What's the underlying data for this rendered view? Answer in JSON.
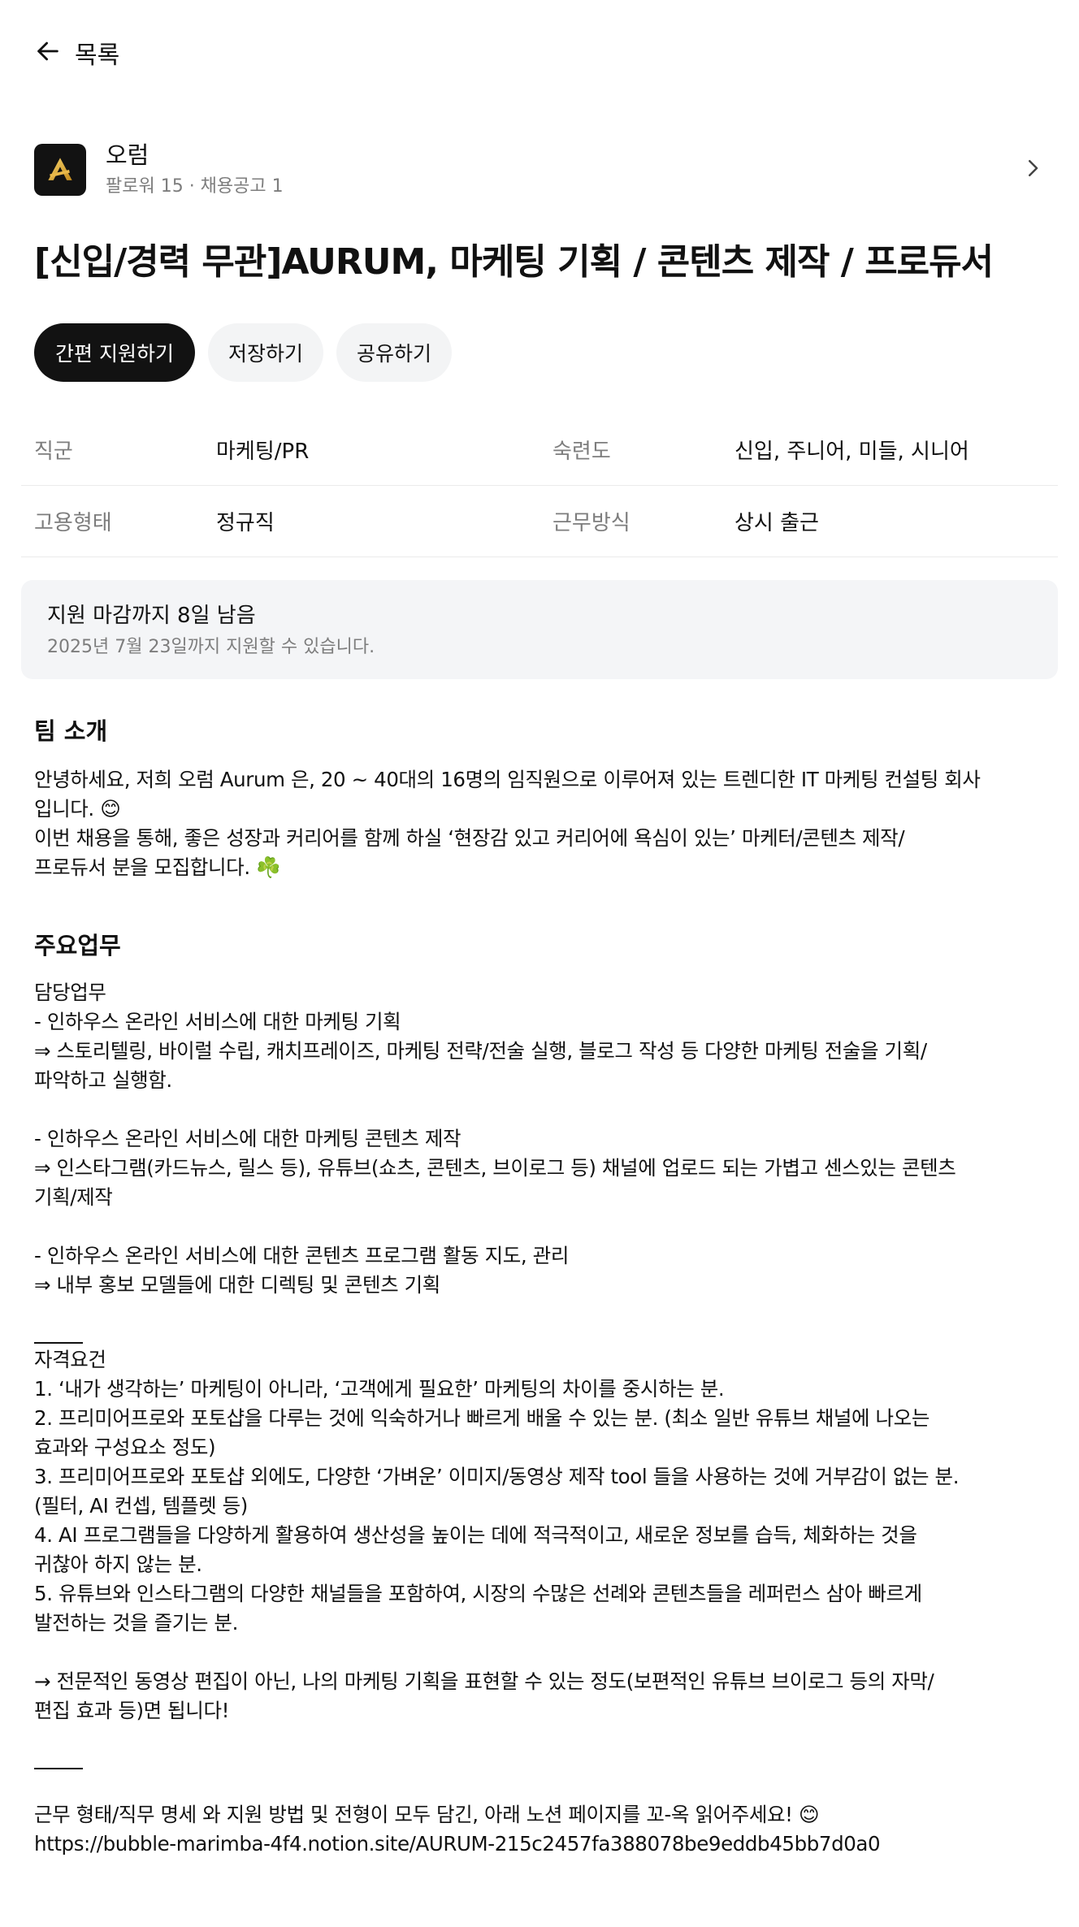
{
  "nav": {
    "back_label": "목록"
  },
  "company": {
    "logo_icon": "aurum-logo-icon",
    "name": "오럼",
    "meta": "팔로워 15 · 채용공고 1"
  },
  "job": {
    "title": "[신입/경력 무관]AURUM, 마케팅 기획 / 콘텐츠 제작 / 프로듀서"
  },
  "actions": {
    "apply": "간편 지원하기",
    "save": "저장하기",
    "share": "공유하기"
  },
  "info": {
    "row1": {
      "label_a": "직군",
      "value_a": "마케팅/PR",
      "label_b": "숙련도",
      "value_b": "신입, 주니어, 미들, 시니어"
    },
    "row2": {
      "label_a": "고용형태",
      "value_a": "정규직",
      "label_b": "근무방식",
      "value_b": "상시 출근"
    }
  },
  "deadline": {
    "title": "지원 마감까지 8일 남음",
    "subtitle": "2025년 7월 23일까지 지원할 수 있습니다."
  },
  "team": {
    "heading": "팀 소개",
    "lines": [
      "안녕하세요, 저희 오럼 Aurum 은, 20 ~ 40대의 16명의 임직원으로 이루어져 있는 트렌디한 IT 마케팅 컨설팅 회사",
      "입니다. 😊",
      "이번 채용을 통해, 좋은 성장과 커리어를 함께 하실 ‘현장감 있고 커리어에 욕심이 있는’ 마케터/콘텐츠 제작/",
      "프로듀서 분을 모집합니다. ☘️"
    ]
  },
  "duties": {
    "heading": "주요업무",
    "lines": [
      "담당업무",
      "- 인하우스 온라인 서비스에 대한 마케팅 기획",
      "⇒ 스토리텔링, 바이럴 수립, 캐치프레이즈, 마케팅 전략/전술 실행, 블로그 작성 등 다양한 마케팅 전술을 기획/",
      "파악하고 실행함.",
      "",
      "- 인하우스 온라인 서비스에 대한 마케팅 콘텐츠 제작",
      "⇒ 인스타그램(카드뉴스, 릴스 등), 유튜브(쇼츠, 콘텐츠, 브이로그 등) 채널에 업로드 되는 가볍고 센스있는 콘텐츠",
      "기획/제작",
      "",
      "- 인하우스 온라인 서비스에 대한 콘텐츠 프로그램 활동 지도, 관리",
      "⇒ 내부 홍보 모델들에 대한 디렉팅 및 콘텐츠 기획"
    ]
  },
  "requirements": {
    "lines": [
      "자격요건",
      "1. ‘내가 생각하는’ 마케팅이 아니라, ‘고객에게 필요한’ 마케팅의 차이를 중시하는 분.",
      "2. 프리미어프로와 포토샵을 다루는 것에 익숙하거나 빠르게 배울 수 있는 분. (최소 일반 유튜브 채널에 나오는",
      "효과와 구성요소 정도)",
      "3. 프리미어프로와 포토샵 외에도, 다양한 ‘가벼운’ 이미지/동영상 제작 tool 들을 사용하는 것에 거부감이 없는 분.",
      "(필터, AI 컨셉, 템플렛 등)",
      "4. AI 프로그램들을 다양하게 활용하여 생산성을 높이는 데에 적극적이고, 새로운 정보를 습득, 체화하는 것을",
      "귀찮아 하지 않는 분.",
      "5. 유튜브와 인스타그램의 다양한 채널들을 포함하여, 시장의 수많은 선례와 콘텐츠들을 레퍼런스 삼아 빠르게",
      "발전하는 것을 즐기는 분.",
      "",
      "→ 전문적인 동영상 편집이 아닌, 나의 마케팅 기획을 표현할 수 있는 정도(보편적인 유튜브 브이로그 등의 자막/",
      "편집 효과 등)면 됩니다!"
    ]
  },
  "notice": {
    "lines": [
      "근무 형태/직무 명세 와 지원 방법 및 전형이 모두 담긴, 아래 노션 페이지를 꼬-옥 읽어주세요! 😊",
      "https://bubble-marimba-4f4.notion.site/AURUM-215c2457fa388078be9eddb45bb7d0a0"
    ]
  }
}
